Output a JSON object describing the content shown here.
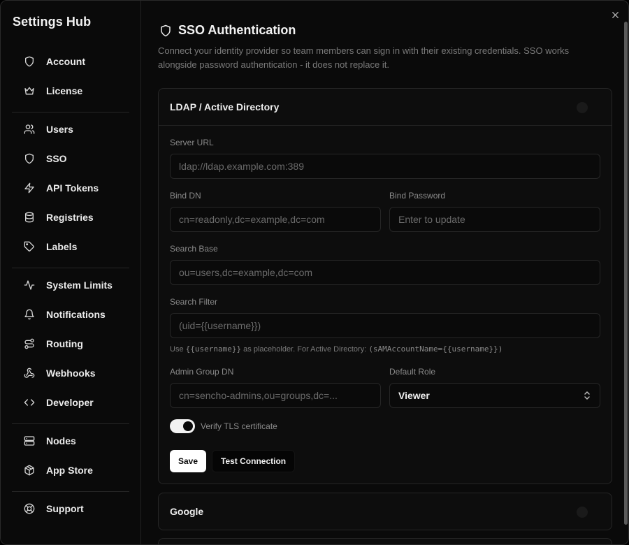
{
  "app": {
    "title": "Settings Hub"
  },
  "sidebar": {
    "items": [
      {
        "label": "Account",
        "icon": "shield-icon"
      },
      {
        "label": "License",
        "icon": "crown-icon"
      },
      {
        "label": "Users",
        "icon": "users-icon"
      },
      {
        "label": "SSO",
        "icon": "shield-icon"
      },
      {
        "label": "API Tokens",
        "icon": "lightning-icon"
      },
      {
        "label": "Registries",
        "icon": "database-icon"
      },
      {
        "label": "Labels",
        "icon": "tag-icon"
      },
      {
        "label": "System Limits",
        "icon": "activity-icon"
      },
      {
        "label": "Notifications",
        "icon": "bell-icon"
      },
      {
        "label": "Routing",
        "icon": "route-icon"
      },
      {
        "label": "Webhooks",
        "icon": "webhook-icon"
      },
      {
        "label": "Developer",
        "icon": "code-icon"
      },
      {
        "label": "Nodes",
        "icon": "server-icon"
      },
      {
        "label": "App Store",
        "icon": "package-icon"
      },
      {
        "label": "Support",
        "icon": "lifebuoy-icon"
      }
    ]
  },
  "main": {
    "title": "SSO Authentication",
    "description": "Connect your identity provider so team members can sign in with their existing credentials. SSO works alongside password authentication - it does not replace it."
  },
  "ldap": {
    "title": "LDAP / Active Directory",
    "server_url": {
      "label": "Server URL",
      "placeholder": "ldap://ldap.example.com:389"
    },
    "bind_dn": {
      "label": "Bind DN",
      "placeholder": "cn=readonly,dc=example,dc=com"
    },
    "bind_password": {
      "label": "Bind Password",
      "placeholder": "Enter to update"
    },
    "search_base": {
      "label": "Search Base",
      "placeholder": "ou=users,dc=example,dc=com"
    },
    "search_filter": {
      "label": "Search Filter",
      "placeholder": "(uid={{username}})"
    },
    "hint_prefix": "Use",
    "hint_code1": "{{username}}",
    "hint_mid": "as placeholder. For Active Directory:",
    "hint_code2": "(sAMAccountName={{username}})",
    "admin_group_dn": {
      "label": "Admin Group DN",
      "placeholder": "cn=sencho-admins,ou=groups,dc=..."
    },
    "default_role": {
      "label": "Default Role",
      "value": "Viewer"
    },
    "verify_tls": {
      "label": "Verify TLS certificate",
      "enabled": true
    },
    "save_label": "Save",
    "test_label": "Test Connection"
  },
  "google": {
    "title": "Google"
  }
}
